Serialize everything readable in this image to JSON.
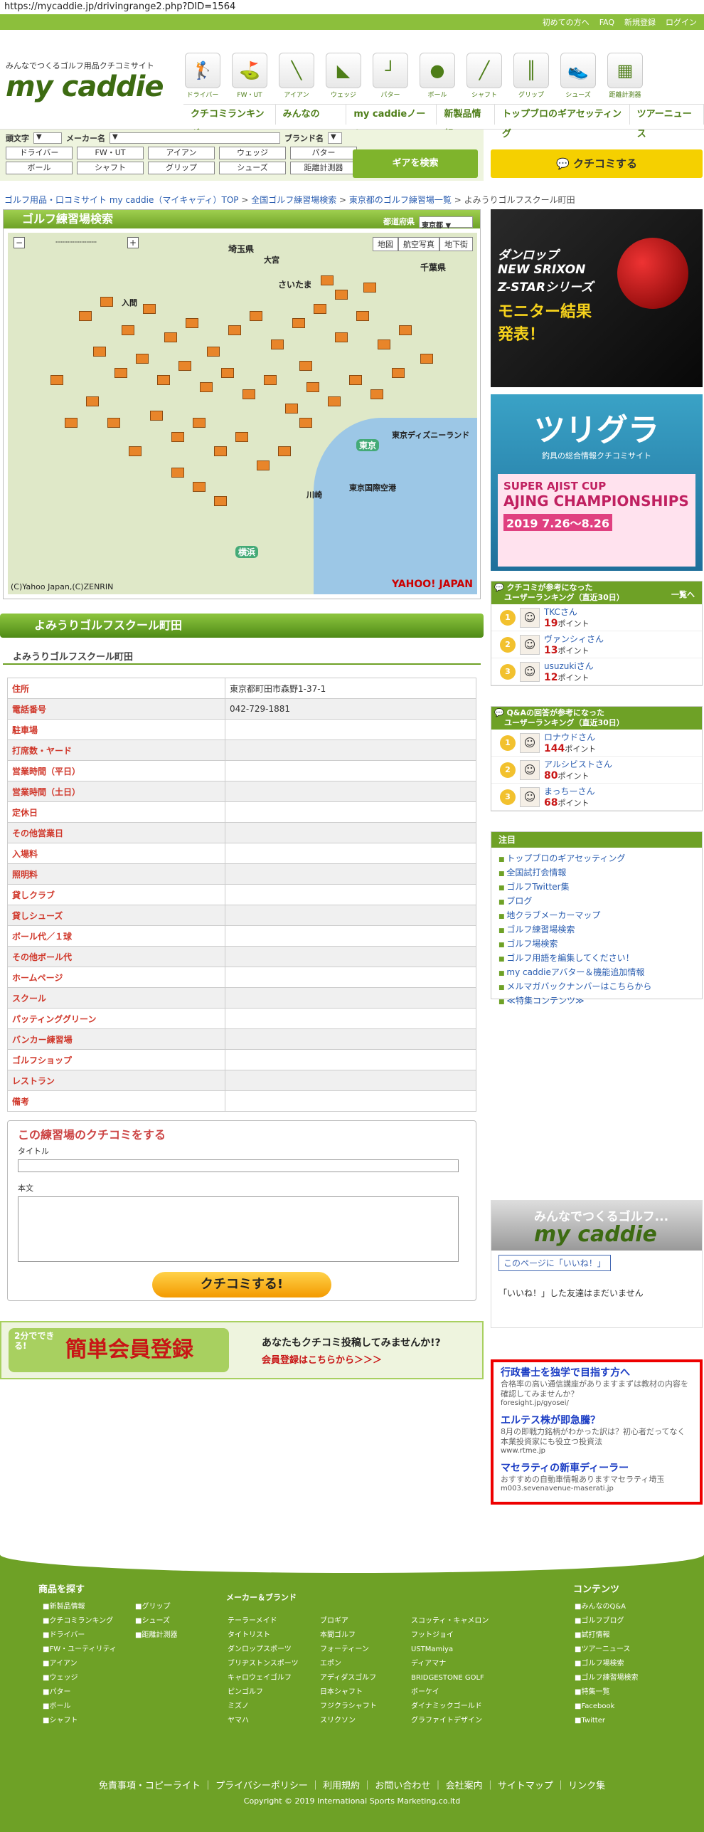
{
  "browser": {
    "url": "https://mycaddie.jp/drivingrange2.php?DID=1564"
  },
  "topbar": {
    "beginner": "初めての方へ",
    "faq": "FAQ",
    "register": "新規登録",
    "login": "ログイン"
  },
  "logo": {
    "tagline": "みんなでつくるゴルフ用品クチコミサイト",
    "name": "my caddie"
  },
  "categories": [
    {
      "label": "ドライバー",
      "icon": "driver-icon"
    },
    {
      "label": "FW・UT",
      "icon": "fairway-wood-icon"
    },
    {
      "label": "アイアン",
      "icon": "iron-icon"
    },
    {
      "label": "ウェッジ",
      "icon": "wedge-icon"
    },
    {
      "label": "パター",
      "icon": "putter-icon"
    },
    {
      "label": "ボール",
      "icon": "ball-icon"
    },
    {
      "label": "シャフト",
      "icon": "shaft-icon"
    },
    {
      "label": "グリップ",
      "icon": "grip-icon"
    },
    {
      "label": "シューズ",
      "icon": "shoes-icon"
    },
    {
      "label": "距離計測器",
      "icon": "rangefinder-icon"
    }
  ],
  "mainnav": [
    "クチコミランキング",
    "みんなのQ&A",
    "my caddieノート",
    "新製品情報",
    "トップブロのギアセッティング",
    "ツアーニュース"
  ],
  "search": {
    "initial_label": "頭文字",
    "maker_label": "メーカー名",
    "brand_label": "ブランド名",
    "buttons": [
      "ドライバー",
      "FW・UT",
      "アイアン",
      "ウェッジ",
      "パター",
      "ボール",
      "シャフト",
      "グリップ",
      "シューズ",
      "距離計測器"
    ],
    "submit": "ギアを検索",
    "kuchikomi": "クチコミする"
  },
  "breadcrumb": [
    "ゴルフ用品・口コミサイト my caddie（マイキャディ）TOP",
    "全国ゴルフ練習場検索",
    "東京都のゴルフ練習場一覧",
    "よみうりゴルフスクール町田"
  ],
  "map": {
    "header": "ゴルフ練習場検索",
    "pref_label": "都道府県",
    "pref_value": "東京都",
    "tabs": [
      "地図",
      "航空写真",
      "地下街"
    ],
    "cities": [
      "埼玉県",
      "さいたま",
      "千葉県",
      "東京",
      "横浜",
      "東京ディズニーランド",
      "東京国際空港",
      "大宮",
      "入間",
      "川崎"
    ],
    "copyright": "(C)Yahoo Japan,(C)ZENRIN",
    "brand": "YAHOO! JAPAN"
  },
  "range": {
    "title": "よみうりゴルフスクール町田",
    "subtitle": "よみうりゴルフスクール町田",
    "rows": [
      {
        "k": "住所",
        "v": "東京都町田市森野1-37-1"
      },
      {
        "k": "電話番号",
        "v": "042-729-1881"
      },
      {
        "k": "駐車場",
        "v": ""
      },
      {
        "k": "打席数・ヤード",
        "v": ""
      },
      {
        "k": "営業時間（平日）",
        "v": ""
      },
      {
        "k": "営業時間（土日）",
        "v": ""
      },
      {
        "k": "定休日",
        "v": ""
      },
      {
        "k": "その他営業日",
        "v": ""
      },
      {
        "k": "入場料",
        "v": ""
      },
      {
        "k": "照明料",
        "v": ""
      },
      {
        "k": "貸しクラブ",
        "v": ""
      },
      {
        "k": "貸しシューズ",
        "v": ""
      },
      {
        "k": "ボール代／１球",
        "v": ""
      },
      {
        "k": "その他ボール代",
        "v": ""
      },
      {
        "k": "ホームページ",
        "v": ""
      },
      {
        "k": "スクール",
        "v": ""
      },
      {
        "k": "パッティンググリーン",
        "v": ""
      },
      {
        "k": "バンカー練習場",
        "v": ""
      },
      {
        "k": "ゴルフショップ",
        "v": ""
      },
      {
        "k": "レストラン",
        "v": ""
      },
      {
        "k": "備考",
        "v": ""
      }
    ]
  },
  "review_form": {
    "heading": "この練習場のクチコミをする",
    "title_label": "タイトル",
    "body_label": "本文",
    "submit": "クチコミする!"
  },
  "signup": {
    "badge": "簡単会員登録",
    "prefix": "2分でできる!",
    "line1": "あなたもクチコミ投稿してみませんか!?",
    "line2": "会員登録はこちらから＞＞＞"
  },
  "ad1": {
    "l1": "ダンロップ",
    "l2": "NEW SRIXON",
    "l3": "Z-STARシリーズ",
    "l4": "モニター結果",
    "l5": "発表！"
  },
  "ad2": {
    "title": "ツリグラ",
    "sub": "釣具の総合情報クチコミサイト",
    "banner1": "SUPER AJIST CUP",
    "banner2": "AJING CHAMPIONSHIPS",
    "banner3": "2019 7.26〜8.26"
  },
  "rank_kuchikomi": {
    "title1": "クチコミが参考になった",
    "title2": "ユーザーランキング（直近30日）",
    "more": "一覧へ",
    "items": [
      {
        "rank": "1",
        "name": "TKCさん",
        "pts": "19",
        "unit": "ポイント"
      },
      {
        "rank": "2",
        "name": "ヴァンシィさん",
        "pts": "13",
        "unit": "ポイント"
      },
      {
        "rank": "3",
        "name": "usuzukiさん",
        "pts": "12",
        "unit": "ポイント"
      }
    ]
  },
  "rank_qa": {
    "title1": "Q&Aの回答が参考になった",
    "title2": "ユーザーランキング（直近30日）",
    "items": [
      {
        "rank": "1",
        "name": "ロナウドさん",
        "pts": "144",
        "unit": "ポイント"
      },
      {
        "rank": "2",
        "name": "アルシビストさん",
        "pts": "80",
        "unit": "ポイント"
      },
      {
        "rank": "3",
        "name": "まっちーさん",
        "pts": "68",
        "unit": "ポイント"
      }
    ]
  },
  "notice": {
    "title": "注目",
    "items": [
      "トップブロのギアセッティング",
      "全国試打会情報",
      "ゴルフTwitter集",
      "ブログ",
      "地クラブメーカーマップ",
      "ゴルフ練習場検索",
      "ゴルフ場検索",
      "ゴルフ用語を編集してください！",
      "my caddieアバター＆機能追加情報",
      "メルマガバックナンバーはこちらから",
      "≪特集コンテンツ≫"
    ]
  },
  "facebook": {
    "title": "みんなでつくるゴルフ...",
    "brand": "my caddie",
    "like": "このページに「いいね！」",
    "msg": "「いいね！」した友達はまだいません"
  },
  "adtext": [
    {
      "t": "行政書士を独学で目指す方へ",
      "d": "合格率の高い通信講座がありますまずは教材の内容を確認してみませんか？",
      "u": "foresight.jp/gyosei/"
    },
    {
      "t": "エルテス株が即急騰？",
      "d": "8月の即戦力銘柄がわかった訳は？初心者だってなく本業投資家にも役立つ投資法",
      "u": "www.rtme.jp"
    },
    {
      "t": "マセラティの新車ディーラー",
      "d": "おすすめの自動車情報ありますマセラティ埼玉",
      "u": "m003.sevenavenue-maserati.jp"
    }
  ],
  "footer": {
    "products_title": "商品を探す",
    "contents_title": "コンテンツ",
    "col1": [
      "新製品情報",
      "クチコミランキング",
      "ドライバー",
      "FW・ユーティリティ",
      "アイアン",
      "ウェッジ",
      "パター",
      "ボール",
      "シャフト"
    ],
    "col2": [
      "グリップ",
      "シューズ",
      "距離計測器"
    ],
    "maker_title": "メーカー＆ブランド",
    "col3": [
      "テーラーメイド",
      "タイトリスト",
      "ダンロップスポーツ",
      "ブリヂストンスポーツ",
      "キャロウェイゴルフ",
      "ピンゴルフ",
      "ミズノ",
      "ヤマハ"
    ],
    "col4": [
      "ブロギア",
      "本間ゴルフ",
      "フォーティーン",
      "エポン",
      "アディダスゴルフ",
      "日本シャフト",
      "フジクラシャフト",
      "スリクソン"
    ],
    "col5": [
      "スコッティ・キャメロン",
      "フットジョイ",
      "USTMamiya",
      "ディアマナ",
      "BRIDGESTONE GOLF",
      "ボーケイ",
      "ダイナミックゴールド",
      "グラファイトデザイン"
    ],
    "col6": [
      "みんなのQ&A",
      "ゴルフブログ",
      "試打情報",
      "ツアーニュース",
      "ゴルフ場検索",
      "ゴルフ練習場検索",
      "特集一覧",
      "Facebook",
      "Twitter"
    ],
    "links": "免責事項・コピーライト ｜ プライバシーポリシー ｜ 利用規約 ｜ お問い合わせ ｜ 会社案内 ｜ サイトマップ ｜ リンク集",
    "copyright": "Copyright © 2019 International Sports Marketing,co.ltd"
  }
}
